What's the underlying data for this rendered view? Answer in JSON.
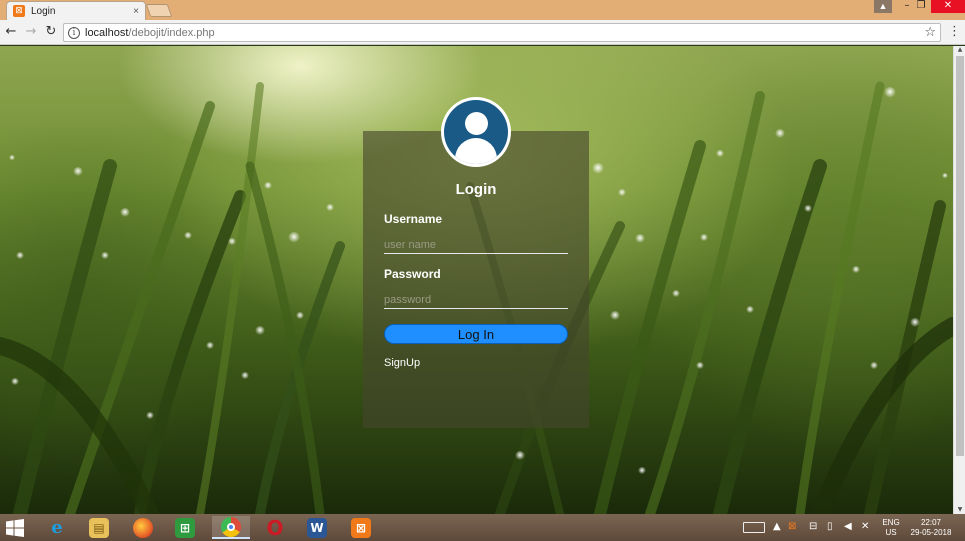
{
  "browser": {
    "tab": {
      "title": "Login",
      "favicon_letter": "⊠",
      "close_glyph": "×"
    },
    "window_controls": {
      "user": "▲",
      "minimize": "–",
      "maximize": "❐",
      "close": "✕"
    },
    "nav": {
      "back": "←",
      "forward": "→",
      "reload": "↻"
    },
    "address": {
      "info_glyph": "i",
      "host": "localhost",
      "path": "/debojit/index.php"
    },
    "star_glyph": "☆",
    "menu_glyph": "⋮",
    "scroll": {
      "up": "▲",
      "down": "▼"
    }
  },
  "login": {
    "title": "Login",
    "username_label": "Username",
    "username_placeholder": "user name",
    "password_label": "Password",
    "password_placeholder": "password",
    "button_label": "Log In",
    "signup_label": "SignUp"
  },
  "taskbar": {
    "apps": [
      {
        "name": "internet-explorer",
        "glyph": "e",
        "color": "#1d9ee3"
      },
      {
        "name": "file-explorer",
        "glyph": "▤",
        "color": "#e8c15a"
      },
      {
        "name": "firefox",
        "glyph": "●",
        "color": "#e8632a"
      },
      {
        "name": "store",
        "glyph": "⊞",
        "color": "#2e9b3f"
      },
      {
        "name": "chrome",
        "glyph": "◉",
        "color": "#dd4b39"
      },
      {
        "name": "opera",
        "glyph": "O",
        "color": "#cc1b24"
      },
      {
        "name": "word",
        "glyph": "W",
        "color": "#2b5797"
      },
      {
        "name": "xampp",
        "glyph": "⊠",
        "color": "#f07a1a"
      }
    ],
    "tray": {
      "chevron": "▲",
      "lang_top": "ENG",
      "lang_bottom": "US",
      "time": "22:07",
      "date": "29-05-2018"
    }
  },
  "colors": {
    "accent_button": "#1f8fff",
    "avatar_blue": "#1a5a86",
    "titlebar": "#e3ad76"
  }
}
